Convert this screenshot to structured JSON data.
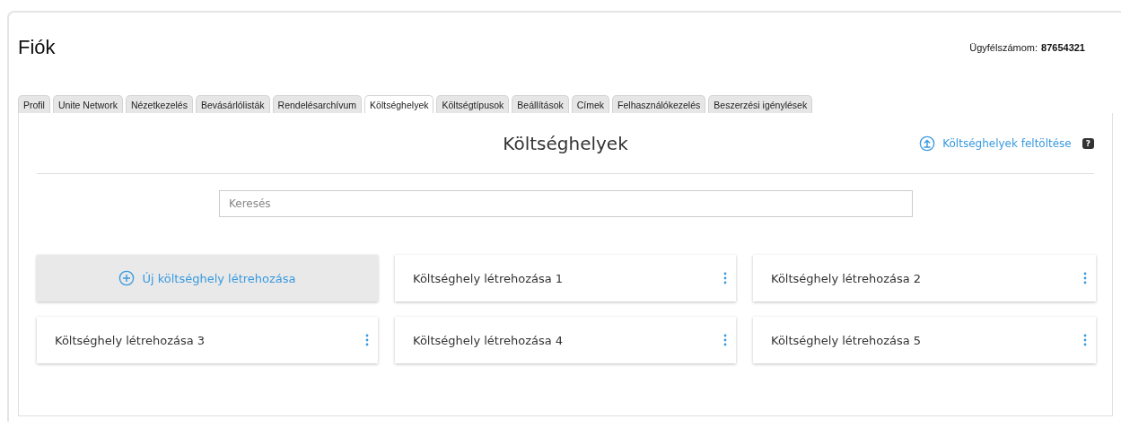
{
  "title": "Fiók",
  "account": {
    "label": "Ügyfélszámom:",
    "number": "87654321"
  },
  "tabs": [
    {
      "label": "Profil",
      "selected": false
    },
    {
      "label": "Unite Network",
      "selected": false
    },
    {
      "label": "Nézetkezelés",
      "selected": false
    },
    {
      "label": "Bevásárlólisták",
      "selected": false
    },
    {
      "label": "Rendelésarchívum",
      "selected": false
    },
    {
      "label": "Költséghelyek",
      "selected": true
    },
    {
      "label": "Költségtípusok",
      "selected": false
    },
    {
      "label": "Beállítások",
      "selected": false
    },
    {
      "label": "Címek",
      "selected": false
    },
    {
      "label": "Felhasználókezelés",
      "selected": false
    },
    {
      "label": "Beszerzési igénylések",
      "selected": false
    }
  ],
  "panel": {
    "heading": "Költséghelyek",
    "upload_link": "Költséghelyek feltöltése",
    "help_badge": "?",
    "search": {
      "placeholder": "Keresés"
    }
  },
  "cards": [
    {
      "kind": "create",
      "label": "Új költséghely létrehozása"
    },
    {
      "kind": "item",
      "label": "Költséghely létrehozása 1"
    },
    {
      "kind": "item",
      "label": "Költséghely létrehozása 2"
    },
    {
      "kind": "item",
      "label": "Költséghely létrehozása 3"
    },
    {
      "kind": "item",
      "label": "Költséghely létrehozása 4"
    },
    {
      "kind": "item",
      "label": "Költséghely létrehozása 5"
    }
  ]
}
